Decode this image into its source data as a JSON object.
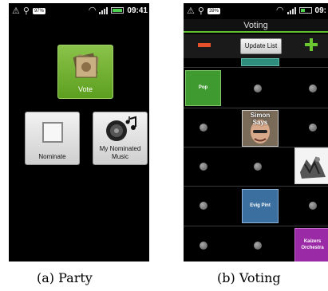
{
  "party": {
    "status": {
      "battery_pct": "97%",
      "clock": "09:41"
    },
    "vote_label": "Vote",
    "nominate_label": "Nominate",
    "my_music_label": "My Nominated Music",
    "caption": "(a) Party"
  },
  "voting": {
    "status": {
      "battery_pct": "39%",
      "clock": "09:"
    },
    "title": "Voting",
    "update_label": "Update List",
    "tiles": {
      "pop": "Pop",
      "simon": "Simon Says",
      "evig": "Evig Pint",
      "kaizers": "Kaizers Orchestra"
    },
    "caption": "(b) Voting"
  },
  "colors": {
    "accent_green": "#63c032",
    "minus_red": "#e5512a",
    "plus_green": "#6bc72f"
  },
  "icons": [
    "warning-icon",
    "usb-icon",
    "wifi-icon",
    "signal-icon",
    "battery-icon",
    "album-stack-icon",
    "speaker-music-icon",
    "checkbox-square-icon"
  ]
}
